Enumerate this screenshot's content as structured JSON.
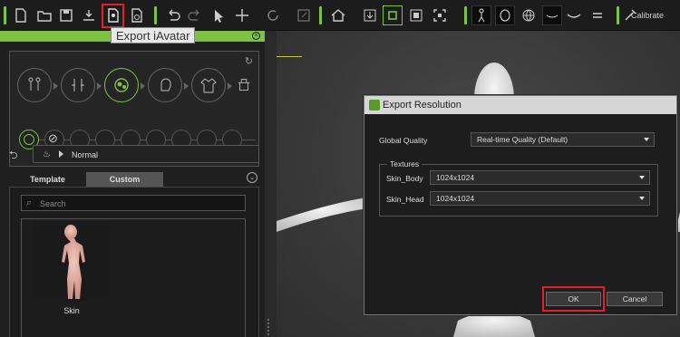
{
  "toolbar": {
    "tooltip": "Export iAvatar",
    "calibrate_label": "Calibrate",
    "icons": [
      "new-file-icon",
      "open-folder-icon",
      "save-icon",
      "export-icon",
      "export-iavatar-icon",
      "export-settings-icon",
      "undo-icon",
      "redo-icon",
      "select-arrow-icon",
      "move-icon",
      "rotate-icon",
      "scale-icon",
      "home-view-icon",
      "download-icon",
      "grid-icon",
      "frame-icon",
      "fit-icon",
      "body-mode-icon",
      "head-mode-icon",
      "globe-icon",
      "eyelash-icon",
      "eye-icon",
      "mouth-icon",
      "calibrate-icon"
    ]
  },
  "panel": {
    "categories": [
      "body-morph",
      "limbs",
      "skin",
      "head",
      "clothing",
      "accessory"
    ],
    "breadcrumb": "Normal",
    "tabs": {
      "template": "Template",
      "custom": "Custom"
    },
    "search_placeholder": "Search",
    "items": [
      {
        "label": "Skin"
      }
    ]
  },
  "dialog": {
    "title": "Export Resolution",
    "global_quality_label": "Global Quality",
    "global_quality_value": "Real-time Quality (Default)",
    "textures_legend": "Textures",
    "textures": [
      {
        "label": "Skin_Body",
        "value": "1024x1024"
      },
      {
        "label": "Skin_Head",
        "value": "1024x1024"
      }
    ],
    "ok_label": "OK",
    "cancel_label": "Cancel"
  },
  "colors": {
    "accent": "#7cc243",
    "highlight": "#e0202a"
  }
}
